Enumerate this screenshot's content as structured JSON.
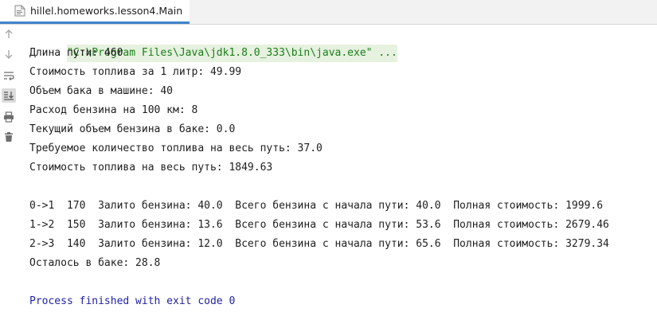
{
  "tab": {
    "title": "hillel.homeworks.lesson4.Main",
    "icon": "java-file-icon"
  },
  "toolbar": {
    "items": [
      {
        "name": "scroll-up-icon"
      },
      {
        "name": "scroll-down-icon"
      },
      {
        "name": "soft-wrap-icon"
      },
      {
        "name": "scroll-to-end-icon"
      },
      {
        "name": "print-icon"
      },
      {
        "name": "trash-icon"
      }
    ]
  },
  "console": {
    "command": "\"C:\\Program Files\\Java\\jdk1.8.0_333\\bin\\java.exe\" ...",
    "lines": [
      "Длина пути: 460",
      "Стоимость топлива за 1 литр: 49.99",
      "Объем бака в машине: 40",
      "Расход бензина на 100 км: 8",
      "Текущий объем бензина в баке: 0.0",
      "Требуемое количество топлива на весь путь: 37.0",
      "Стоимость топлива на весь путь: 1849.63",
      "",
      "0->1  170  Залито бензина: 40.0  Всего бензина с начала пути: 40.0  Полная стоимость: 1999.6",
      "1->2  150  Залито бензина: 13.6  Всего бензина с начала пути: 53.6  Полная стоимость: 2679.46",
      "2->3  140  Залито бензина: 12.0  Всего бензина с начала пути: 65.6  Полная стоимость: 3279.34",
      "Осталось в баке: 28.8",
      ""
    ],
    "exit_message": "Process finished with exit code 0"
  },
  "colors": {
    "tab_accent": "#4083c9",
    "command_text": "#1a7f1a",
    "command_background": "#e6f1df",
    "exit_text": "#2222a8"
  }
}
